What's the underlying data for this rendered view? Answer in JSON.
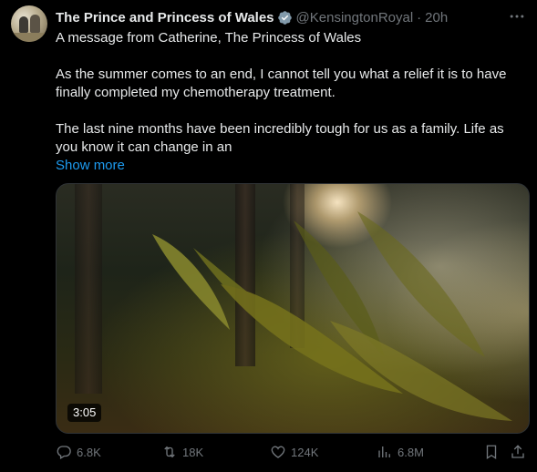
{
  "author": {
    "name": "The Prince and Princess of Wales",
    "handle": "@KensingtonRoyal",
    "separator": "·",
    "time": "20h"
  },
  "body": {
    "line1": "A message from Catherine, The Princess of Wales",
    "line2": "As the summer comes to an end, I cannot tell you what a relief it is to have finally completed my chemotherapy treatment.",
    "line3": "The last nine months have been incredibly tough for us as a family. Life as you know it can change in an",
    "show_more": "Show more"
  },
  "media": {
    "duration": "3:05"
  },
  "actions": {
    "replies": "6.8K",
    "reposts": "18K",
    "likes": "124K",
    "views": "6.8M"
  },
  "icons": {
    "verified": "verified-badge-icon",
    "more": "more-icon",
    "reply": "reply-icon",
    "repost": "repost-icon",
    "like": "heart-icon",
    "views": "views-icon",
    "bookmark": "bookmark-icon",
    "share": "share-icon"
  },
  "colors": {
    "background": "#000000",
    "text": "#e7e9ea",
    "muted": "#71767b",
    "link": "#1d9bf0"
  }
}
